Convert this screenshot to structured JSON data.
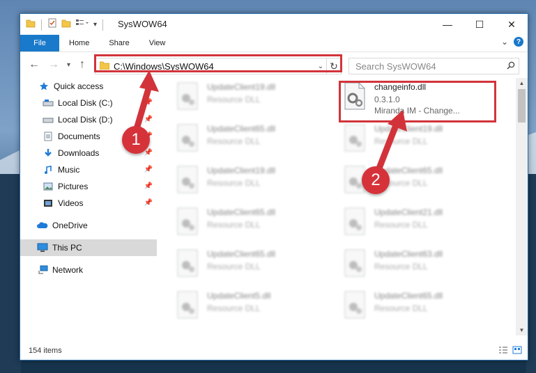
{
  "window": {
    "title": "SysWOW64",
    "minimize": "—",
    "maximize": "☐",
    "close": "✕"
  },
  "ribbon": {
    "tabs": [
      "File",
      "Home",
      "Share",
      "View"
    ],
    "expand": "⌄",
    "help": "?"
  },
  "address": {
    "path": "C:\\Windows\\SysWOW64",
    "dropdown": "⌄",
    "refresh": "↻"
  },
  "search": {
    "placeholder": "Search SysWOW64",
    "icon": "search-icon"
  },
  "sidebar": {
    "items": [
      {
        "label": "Quick access",
        "icon": "star-icon"
      },
      {
        "label": "Local Disk (C:)",
        "icon": "drive-icon",
        "pinned": true
      },
      {
        "label": "Local Disk (D:)",
        "icon": "drive-icon",
        "pinned": true
      },
      {
        "label": "Documents",
        "icon": "documents-icon",
        "pinned": true
      },
      {
        "label": "Downloads",
        "icon": "downloads-icon",
        "pinned": true
      },
      {
        "label": "Music",
        "icon": "music-icon",
        "pinned": true
      },
      {
        "label": "Pictures",
        "icon": "pictures-icon",
        "pinned": true
      },
      {
        "label": "Videos",
        "icon": "videos-icon",
        "pinned": true
      },
      {
        "label": "OneDrive",
        "icon": "cloud-icon"
      },
      {
        "label": "This PC",
        "icon": "computer-icon",
        "selected": true
      },
      {
        "label": "Network",
        "icon": "network-icon"
      }
    ]
  },
  "files": {
    "highlighted": {
      "name": "changeinfo.dll",
      "version": "0.3.1.0",
      "description": "Miranda IM - Change..."
    },
    "left_column": [
      {
        "name": "UpdateClient19.dll",
        "type": "Resource DLL"
      },
      {
        "name": "UpdateClient65.dll",
        "type": "Resource DLL"
      },
      {
        "name": "UpdateClient19.dll",
        "type": "Resource DLL"
      },
      {
        "name": "UpdateClient65.dll",
        "type": "Resource DLL"
      },
      {
        "name": "UpdateClient65.dll",
        "type": "Resource DLL"
      },
      {
        "name": "UpdateClient5.dll",
        "type": "Resource DLL"
      }
    ],
    "right_column": [
      {
        "name": "UpdateClient19.dll",
        "type": "Resource DLL"
      },
      {
        "name": "UpdateClient65.dll",
        "type": "Resource DLL"
      },
      {
        "name": "UpdateClient21.dll",
        "type": "Resource DLL"
      },
      {
        "name": "UpdateClient63.dll",
        "type": "Resource DLL"
      },
      {
        "name": "UpdateClient65.dll",
        "type": "Resource DLL"
      }
    ]
  },
  "status": {
    "item_count": "154 items"
  },
  "annotations": {
    "step1": "1",
    "step2": "2",
    "color": "#d2333a"
  }
}
